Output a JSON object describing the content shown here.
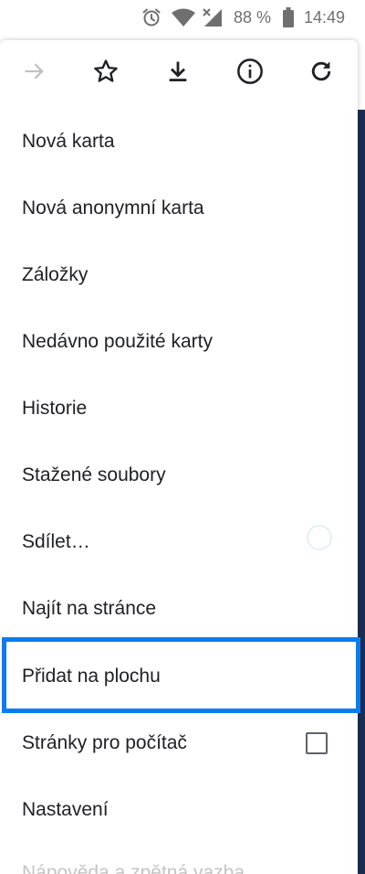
{
  "status_bar": {
    "battery_percent": "88 %",
    "time": "14:49",
    "icons": [
      "alarm-icon",
      "wifi-icon",
      "signal-icon",
      "battery-icon"
    ]
  },
  "toolbar": {
    "icons": [
      "forward-arrow-icon",
      "star-icon",
      "download-icon",
      "info-icon",
      "refresh-icon"
    ]
  },
  "menu": {
    "items": [
      {
        "label": "Nová karta"
      },
      {
        "label": "Nová anonymní karta"
      },
      {
        "label": "Záložky"
      },
      {
        "label": "Nedávno použité karty"
      },
      {
        "label": "Historie"
      },
      {
        "label": "Stažené soubory"
      },
      {
        "label": "Sdílet…"
      },
      {
        "label": "Najít na stránce"
      },
      {
        "label": "Přidat na plochu"
      },
      {
        "label": "Stránky pro počítač",
        "checked": false
      },
      {
        "label": "Nastavení"
      },
      {
        "label": "Nápověda a zpětná vazba"
      }
    ]
  },
  "colors": {
    "highlight": "#0a7cf0",
    "text": "#202124",
    "page_edge": "#1a2d55"
  }
}
